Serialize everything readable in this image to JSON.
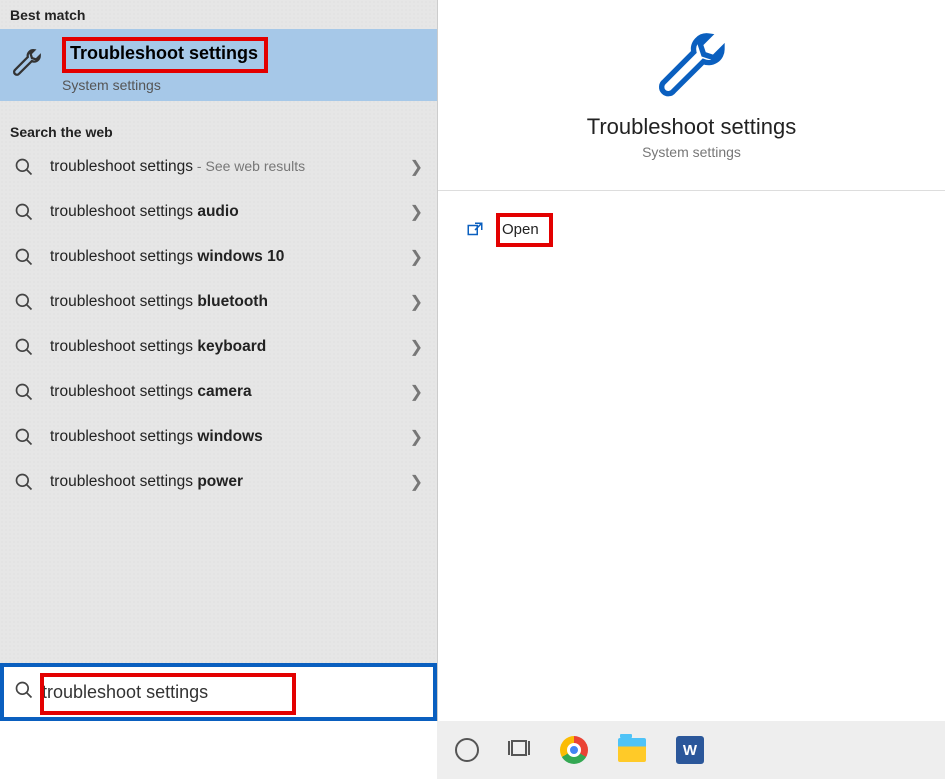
{
  "left": {
    "best_match_header": "Best match",
    "best_item": {
      "title": "Troubleshoot settings",
      "subtitle": "System settings"
    },
    "web_header": "Search the web",
    "web_items": [
      {
        "base": "troubleshoot settings",
        "bold": "",
        "hint": " - See web results"
      },
      {
        "base": "troubleshoot settings ",
        "bold": "audio",
        "hint": ""
      },
      {
        "base": "troubleshoot settings ",
        "bold": "windows 10",
        "hint": ""
      },
      {
        "base": "troubleshoot settings ",
        "bold": "bluetooth",
        "hint": ""
      },
      {
        "base": "troubleshoot settings ",
        "bold": "keyboard",
        "hint": ""
      },
      {
        "base": "troubleshoot settings ",
        "bold": "camera",
        "hint": ""
      },
      {
        "base": "troubleshoot settings ",
        "bold": "windows",
        "hint": ""
      },
      {
        "base": "troubleshoot settings ",
        "bold": "power",
        "hint": ""
      }
    ],
    "search_value": "troubleshoot settings"
  },
  "right": {
    "title": "Troubleshoot settings",
    "subtitle": "System settings",
    "action_label": "Open"
  },
  "taskbar": {
    "word_letter": "W"
  }
}
